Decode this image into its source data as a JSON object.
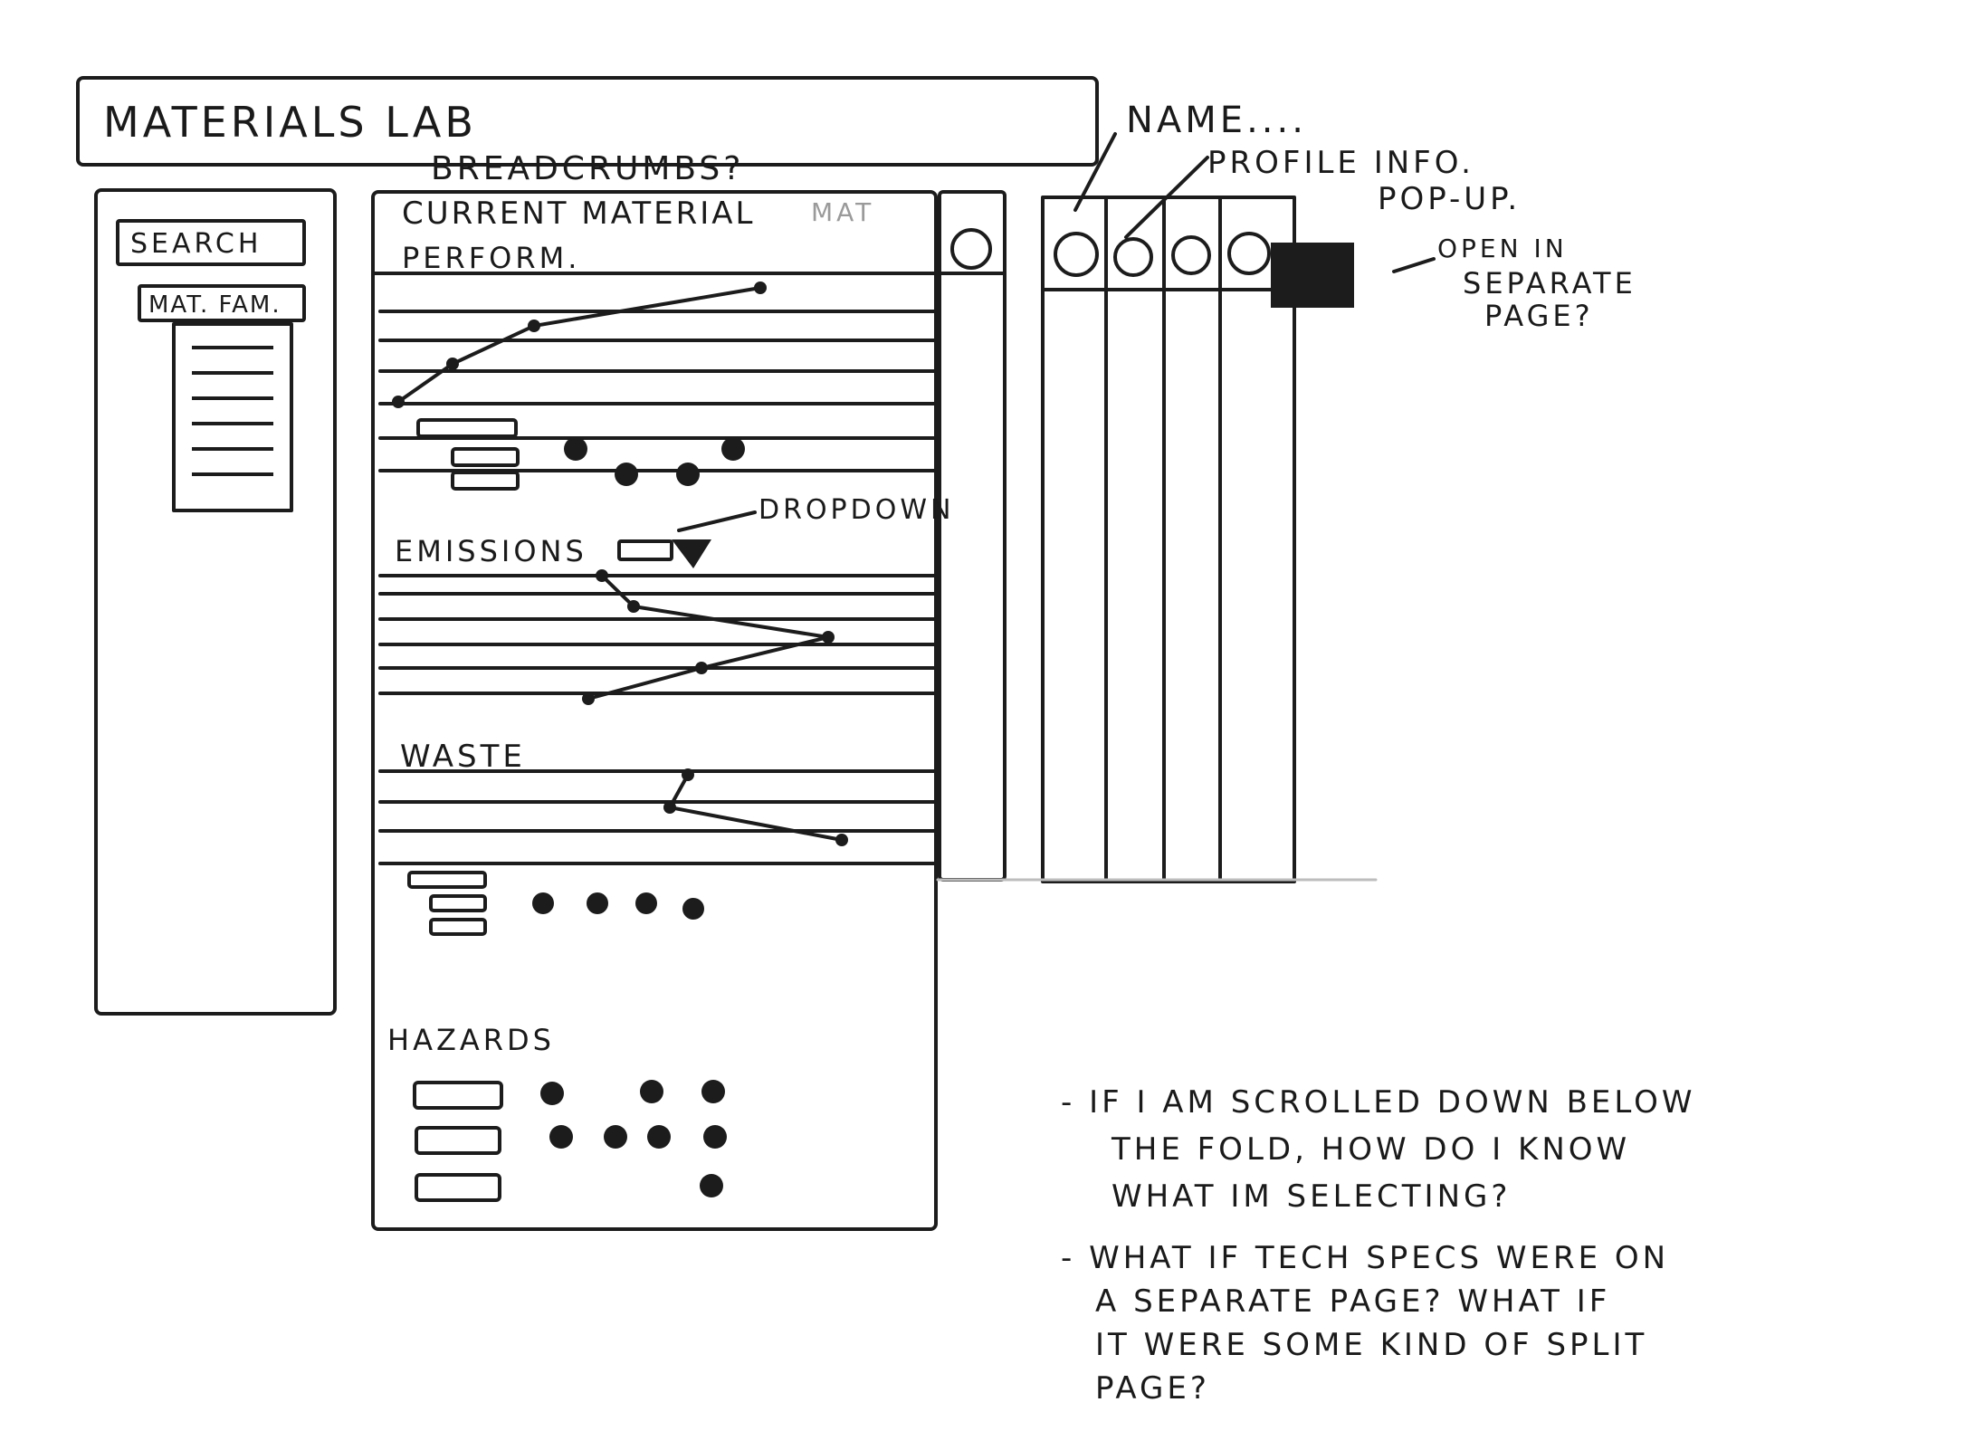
{
  "header": {
    "title": "MATERIALS LAB"
  },
  "sidebar": {
    "search_label": "SEARCH",
    "family_label": "MAT. FAM.",
    "family_items": [
      "",
      "",
      "",
      "",
      "",
      ""
    ]
  },
  "main": {
    "breadcrumb_note": "BREADCRUMBS?",
    "current_material_label": "CURRENT MATERIAL",
    "ghost_label": "MAT",
    "performance_title": "PERFORM.",
    "emissions_title": "EMISSIONS",
    "dropdown_note": "DROPDOWN",
    "waste_title": "WASTE",
    "hazards_title": "HAZARDS",
    "performance_chart": {
      "x": [
        420,
        170,
        80,
        20
      ],
      "y": [
        1,
        2,
        3,
        4
      ]
    },
    "emissions_chart": {
      "x": [
        25,
        60,
        275,
        135,
        10
      ],
      "y": [
        1,
        2,
        3,
        4,
        5
      ]
    },
    "waste_chart": {
      "x": [
        120,
        100,
        290
      ],
      "y": [
        1,
        2,
        3
      ]
    }
  },
  "compare": {
    "name_note": "NAME....",
    "profile_note_line1": "PROFILE INFO.",
    "profile_note_line2": "POP-UP.",
    "open_note_line1": "OPEN IN",
    "open_note_line2": "SEPARATE",
    "open_note_line3": "PAGE?"
  },
  "notes": {
    "note1_line1": "- IF I AM SCROLLED DOWN BELOW",
    "note1_line2": "THE FOLD, HOW DO I KNOW",
    "note1_line3": "WHAT IM SELECTING?",
    "note2_line1": "- WHAT IF TECH SPECS WERE ON",
    "note2_line2": "A SEPARATE PAGE? WHAT IF",
    "note2_line3": "IT WERE SOME KIND OF SPLIT",
    "note2_line4": "PAGE?"
  }
}
